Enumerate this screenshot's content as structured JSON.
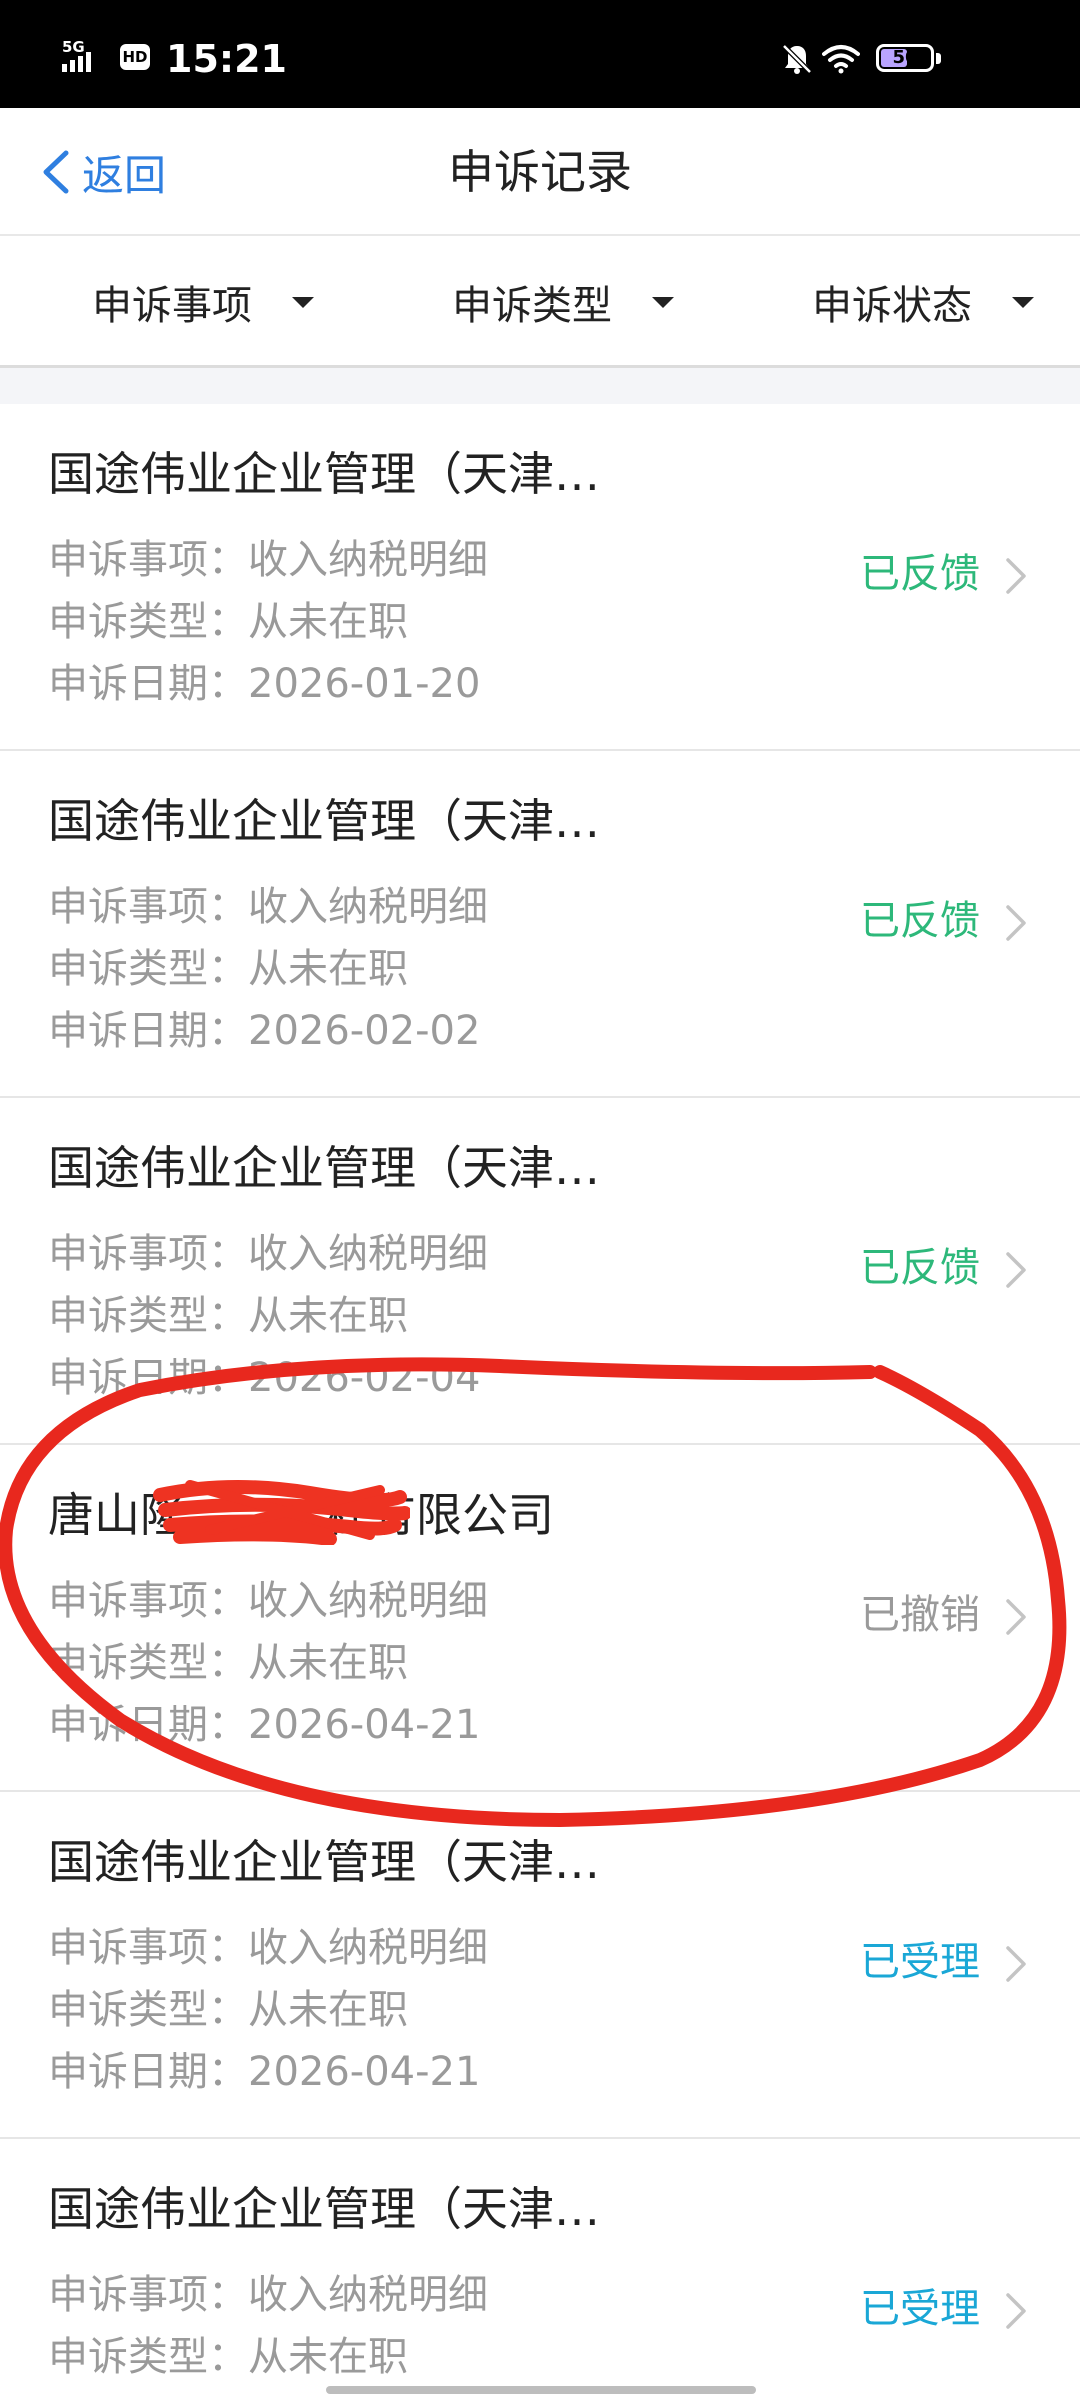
{
  "status_bar": {
    "network": "5G",
    "hd": "HD",
    "time": "15:21",
    "battery": "50"
  },
  "nav": {
    "back_label": "返回",
    "title": "申诉记录"
  },
  "filters": [
    {
      "label": "申诉事项"
    },
    {
      "label": "申诉类型"
    },
    {
      "label": "申诉状态"
    }
  ],
  "records": [
    {
      "company": "国途伟业企业管理（天津…",
      "item": "申诉事项：收入纳税明细",
      "type": "申诉类型：从未在职",
      "date": "申诉日期：2026-01-20",
      "status": "已反馈"
    },
    {
      "company": "国途伟业企业管理（天津…",
      "item": "申诉事项：收入纳税明细",
      "type": "申诉类型：从未在职",
      "date": "申诉日期：2026-02-02",
      "status": "已反馈"
    },
    {
      "company": "国途伟业企业管理（天津…",
      "item": "申诉事项：收入纳税明细",
      "type": "申诉类型：从未在职",
      "date": "申诉日期：2026-02-04",
      "status": "已反馈"
    },
    {
      "company": "唐山隆　　　程有限公司",
      "item": "申诉事项：收入纳税明细",
      "type": "申诉类型：从未在职",
      "date": "申诉日期：2026-04-21",
      "status": "已撤销"
    },
    {
      "company": "国途伟业企业管理（天津…",
      "item": "申诉事项：收入纳税明细",
      "type": "申诉类型：从未在职",
      "date": "申诉日期：2026-04-21",
      "status": "已受理"
    },
    {
      "company": "国途伟业企业管理（天津…",
      "item": "申诉事项：收入纳税明细",
      "type": "申诉类型：从未在职",
      "date": "",
      "status": "已受理"
    }
  ],
  "colors": {
    "accent": "#2f7fe0",
    "feedback": "#2db87a",
    "withdrawn": "#9a9a9a",
    "accepted": "#1aa7d6",
    "annotation": "#e8281e"
  }
}
